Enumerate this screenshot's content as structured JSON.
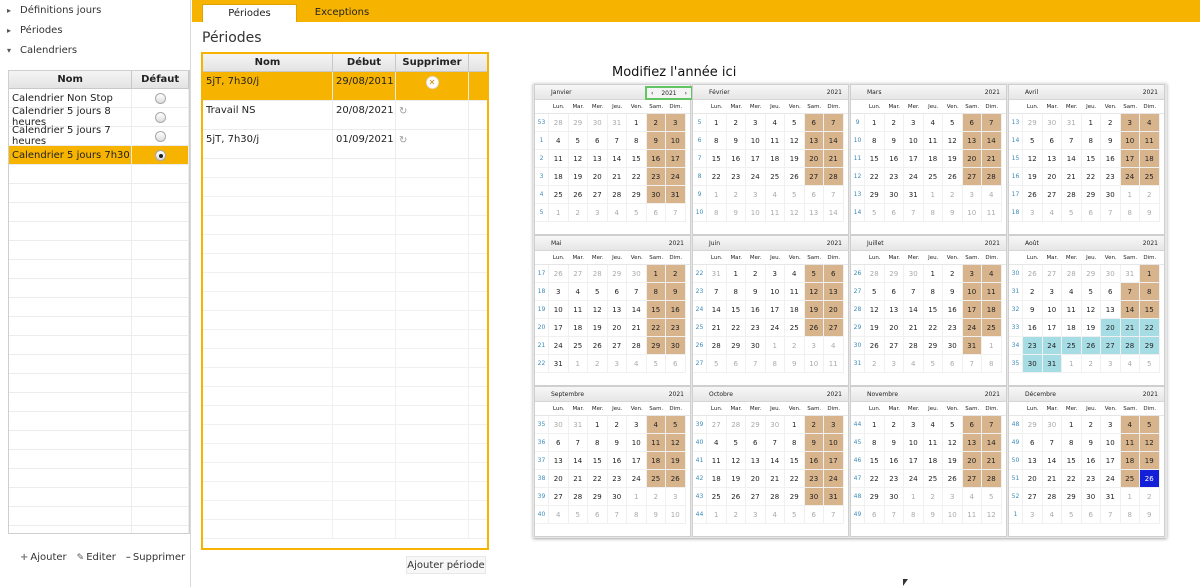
{
  "nav": {
    "items": [
      {
        "label": "Définitions jours",
        "arrow": "▸"
      },
      {
        "label": "Périodes",
        "arrow": "▸"
      },
      {
        "label": "Calendriers",
        "arrow": "▾"
      }
    ]
  },
  "calendars": {
    "headers": {
      "name": "Nom",
      "default": "Défaut"
    },
    "rows": [
      {
        "name": "Calendrier Non Stop",
        "default": false,
        "selected": false
      },
      {
        "name": "Calendrier 5 jours 8 heures",
        "default": false,
        "selected": false
      },
      {
        "name": "Calendrier 5 jours 7 heures",
        "default": false,
        "selected": false
      },
      {
        "name": "Calendrier 5 jours 7h30",
        "default": true,
        "selected": true
      }
    ],
    "actions": {
      "add": "Ajouter",
      "edit": "Editer",
      "delete": "Supprimer"
    }
  },
  "tabs": [
    {
      "label": "Périodes",
      "active": true
    },
    {
      "label": "Exceptions",
      "active": false
    }
  ],
  "periods": {
    "title": "Périodes",
    "headers": {
      "name": "Nom",
      "start": "Début",
      "delete": "Supprimer"
    },
    "rows": [
      {
        "name": "5jT, 7h30/j",
        "start": "29/08/2011",
        "selected": true
      },
      {
        "name": "Travail NS",
        "start": "20/08/2021",
        "selected": false
      },
      {
        "name": "5jT, 7h30/j",
        "start": "01/09/2021",
        "selected": false
      }
    ],
    "add_button": "Ajouter période"
  },
  "calendar": {
    "annotation": "Modifiez l'année ici",
    "year": "2021",
    "days_header": [
      "Lun.",
      "Mar.",
      "Mer.",
      "Jeu.",
      "Ven.",
      "Sam.",
      "Dim."
    ],
    "months": [
      "Janvier",
      "Février",
      "Mars",
      "Avril",
      "Mai",
      "Juin",
      "Juillet",
      "Août",
      "Septembre",
      "Octobre",
      "Novembre",
      "Décembre"
    ],
    "colors": {
      "weekend": "#d8b48c",
      "exception": "#a6dde4",
      "today": "#1420d8",
      "accent": "#f6b400"
    },
    "special_days": {
      "exception": [
        "2021-08-20",
        "2021-08-21",
        "2021-08-22",
        "2021-08-23",
        "2021-08-24",
        "2021-08-25",
        "2021-08-26",
        "2021-08-27",
        "2021-08-28",
        "2021-08-29",
        "2021-08-30",
        "2021-08-31"
      ],
      "today": "2021-12-26"
    }
  }
}
